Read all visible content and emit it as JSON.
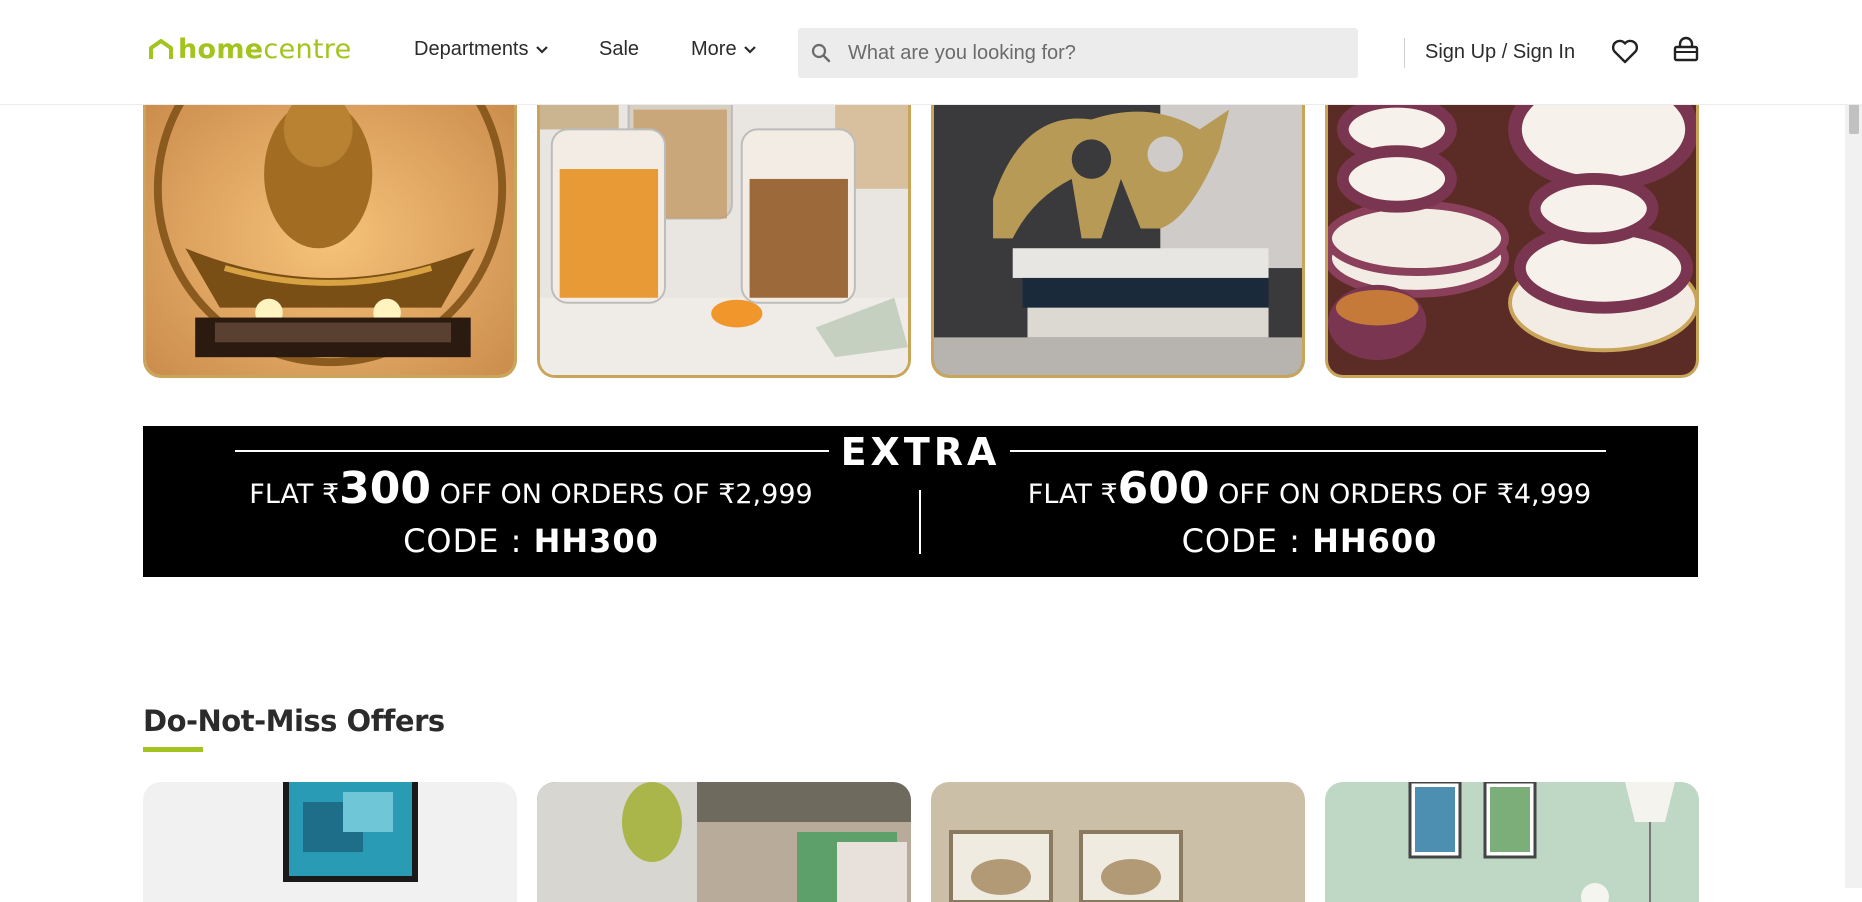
{
  "brand": {
    "name_bold": "home",
    "name_light": "centre",
    "color": "#a3c41f"
  },
  "nav": {
    "departments": "Departments",
    "sale": "Sale",
    "more": "More"
  },
  "search": {
    "placeholder": "What are you looking for?"
  },
  "account": {
    "signin_label": "Sign Up / Sign In"
  },
  "icons": [
    "search-icon",
    "heart-icon",
    "bag-icon",
    "chevron-down-icon"
  ],
  "categories": [
    {
      "name": "ganesha-decor"
    },
    {
      "name": "glass-jars"
    },
    {
      "name": "bull-sculpture"
    },
    {
      "name": "dinner-set"
    }
  ],
  "banner": {
    "heading": "EXTRA",
    "offers": [
      {
        "prefix": "FLAT ₹",
        "amount": "300",
        "suffix": " OFF ON ORDERS OF ₹2,999",
        "code_label": "CODE : ",
        "code": "HH300"
      },
      {
        "prefix": "FLAT ₹",
        "amount": "600",
        "suffix": " OFF ON ORDERS OF ₹4,999",
        "code_label": "CODE : ",
        "code": "HH600"
      }
    ]
  },
  "section": {
    "title": "Do-Not-Miss Offers",
    "accent": "#a3c41f"
  }
}
